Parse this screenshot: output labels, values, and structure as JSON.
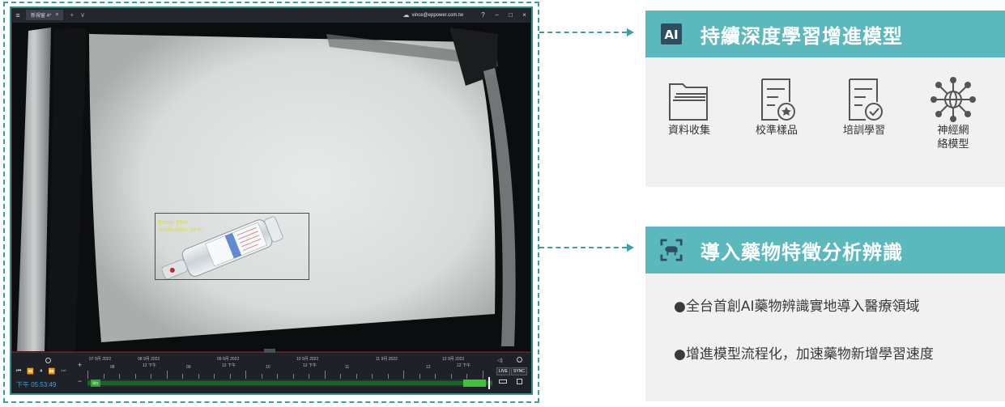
{
  "screenshot": {
    "titlebar": {
      "menu_icon": "hamburger-icon",
      "tab_label": "新視窗 4*",
      "tab_close": "×",
      "add": "+",
      "more": "∨",
      "user": "vince@eppower.com.tw",
      "help": "?",
      "minimize": "−",
      "maximize": "□",
      "close": "×"
    },
    "detection": {
      "label_line1": "Bottle 96%",
      "label_line2": "Medication 94%"
    },
    "playback": {
      "time": "下午 05:53:49",
      "timeline_labels": [
        {
          "text": "07 9月 2022"
        },
        {
          "text": "08"
        },
        {
          "text": "08 9月 2022"
        },
        {
          "text": "12 下午"
        },
        {
          "text": "09"
        },
        {
          "text": "09 9月 2022"
        },
        {
          "text": "12 下午"
        },
        {
          "text": "10"
        },
        {
          "text": "10 9月 2022"
        },
        {
          "text": "12 下午"
        },
        {
          "text": "11"
        },
        {
          "text": "11 9月 2022"
        },
        {
          "text": "12"
        },
        {
          "text": "12 9月 2022"
        },
        {
          "text": "12 下午"
        }
      ],
      "live": "LIVE",
      "sync": "SYNC",
      "start_chip": "現在"
    }
  },
  "panel_top": {
    "title": "持續深度學習增進模型",
    "icon": "ai-chip-icon",
    "features": [
      {
        "label": "資料收集",
        "icon": "folder-stack-icon"
      },
      {
        "label": "校準樣品",
        "icon": "document-star-icon"
      },
      {
        "label": "培訓學習",
        "icon": "document-check-icon"
      },
      {
        "label": "神經網\n絡模型",
        "icon": "neural-network-icon"
      }
    ]
  },
  "panel_bottom": {
    "title": "導入藥物特徵分析辨識",
    "icon": "scan-cow-icon",
    "bullets": [
      "●全台首創AI藥物辨識實地導入醫療領域",
      "●增進模型流程化，加速藥物新增學習速度"
    ]
  },
  "colors": {
    "teal": "#5bb9bd",
    "dashed": "#3aa0a0",
    "panel_bg": "#f1f1f1"
  }
}
